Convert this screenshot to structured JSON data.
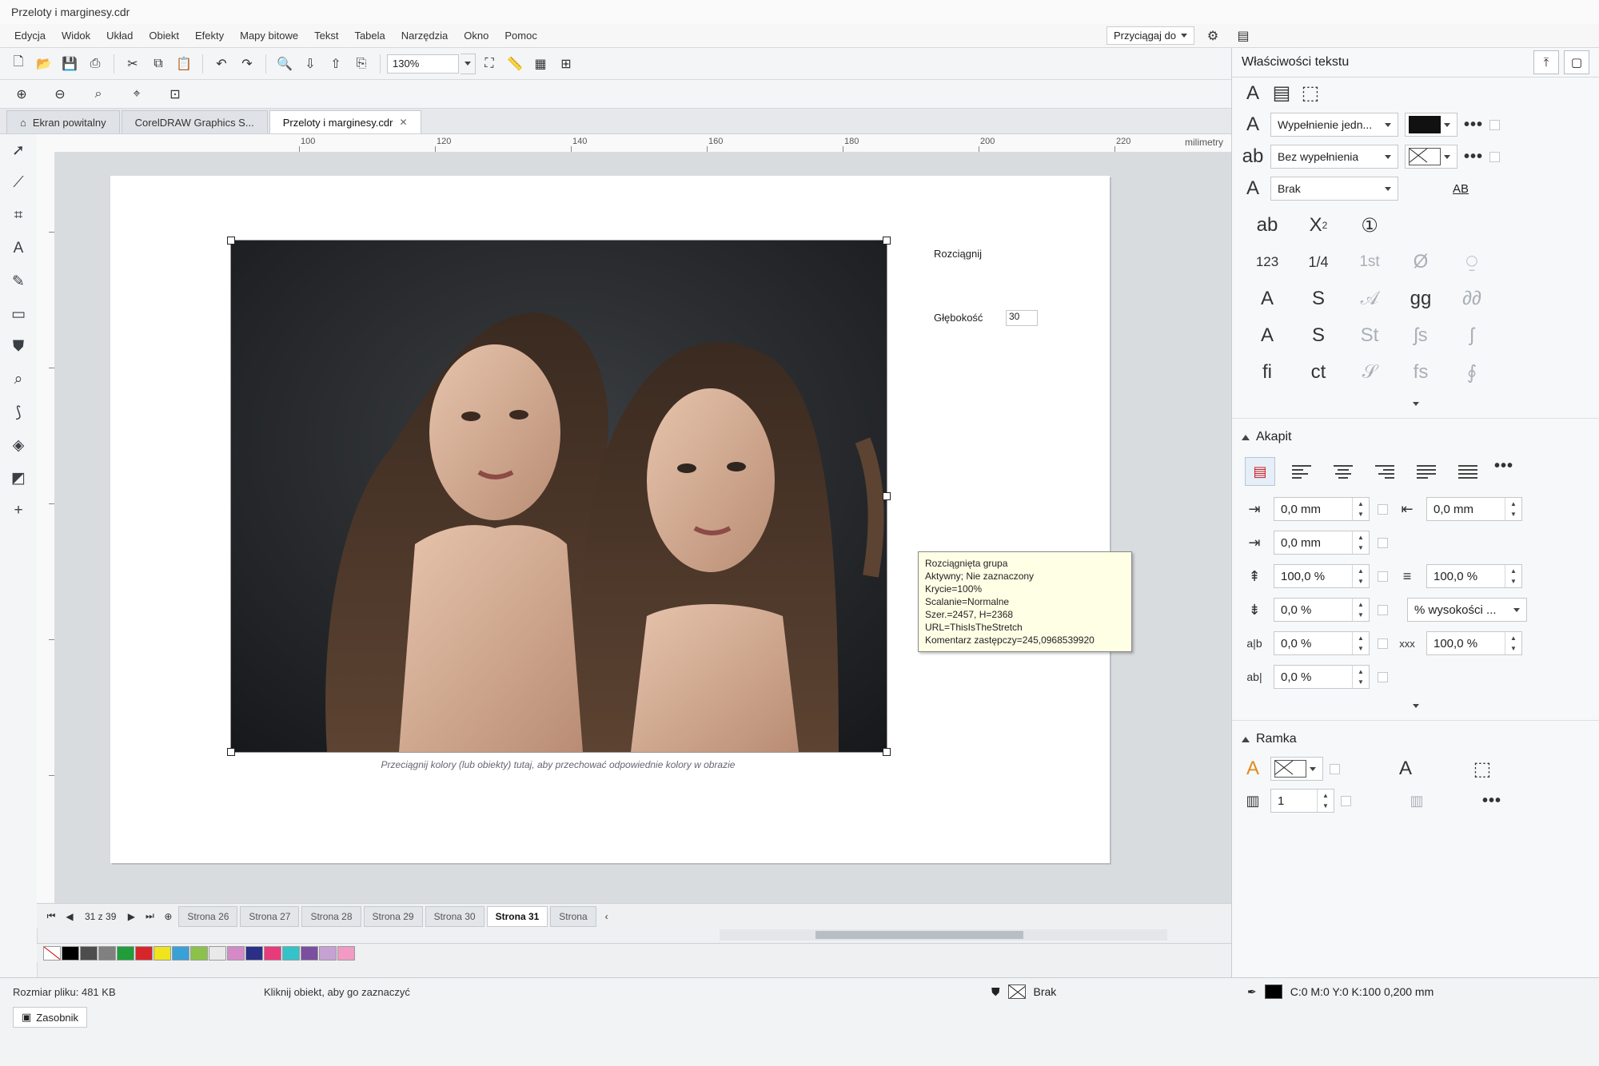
{
  "window": {
    "title": "Przeloty i marginesy.cdr"
  },
  "menu": [
    "Edycja",
    "Widok",
    "Układ",
    "Obiekt",
    "Efekty",
    "Mapy bitowe",
    "Tekst",
    "Tabela",
    "Narzędzia",
    "Okno",
    "Pomoc"
  ],
  "toolbar": {
    "snap_label": "Przyciągaj do",
    "zoom_value": "130%"
  },
  "propbar": {
    "stretch_label": "Rozciągnij",
    "depth_label": "Głębokość",
    "depth_value": "30"
  },
  "tabs": [
    {
      "label": "Ekran powitalny"
    },
    {
      "label": "CorelDRAW Graphics S..."
    },
    {
      "label": "Przeloty i marginesy.cdr"
    }
  ],
  "ruler": {
    "unit": "milimetry",
    "ticks": [
      "100",
      "120",
      "140",
      "160",
      "180",
      "200",
      "220"
    ]
  },
  "canvas": {
    "hint": "Przeciągnij kolory (lub obiekty) tutaj, aby przechować odpowiednie kolory w obrazie",
    "tooltip": [
      "Rozciągnięta grupa",
      "Aktywny; Nie zaznaczony",
      "Krycie=100%",
      "Scalanie=Normalne",
      "Szer.=2457, H=2368",
      "URL=ThisIsTheStretch",
      "Komentarz zastępczy=245,0968539920"
    ]
  },
  "pages": {
    "current": "31",
    "total": "39",
    "count_label": "31 z 39",
    "tabs": [
      "Strona 26",
      "Strona 27",
      "Strona 28",
      "Strona 29",
      "Strona 30",
      "Strona 31",
      "Strona"
    ],
    "active": "Strona 31"
  },
  "palette": [
    "#000000",
    "#4d4d4d",
    "#808080",
    "#1f9e3a",
    "#d7262a",
    "#f0e51c",
    "#3aa0d8",
    "#8bc34a",
    "#e9e9e9",
    "#d48ac6",
    "#2c2f87",
    "#e83b7c",
    "#35c3c9",
    "#7b4fa0",
    "#c6a2d4",
    "#f29ac4"
  ],
  "status": {
    "file_size": "Rozmiar pliku: 481 KB",
    "tip": "Kliknij obiekt, aby go zaznaczyć",
    "docker_tab": "Zasobnik",
    "fill_label": "Brak",
    "outline_label": "C:0 M:0 Y:0 K:100  0,200 mm"
  },
  "docker": {
    "title": "Właściwości tekstu",
    "fill_dd": "Wypełnienie jedn...",
    "bg_dd": "Bez wypełnienia",
    "outline_dd": "Brak",
    "outline_icon_label": "AB",
    "glyphs": {
      "row1": [
        "ab",
        "X",
        "①"
      ],
      "row2": [
        "123",
        "1/4",
        "1st",
        "Ø",
        "⍜"
      ],
      "row3": [
        "A",
        "S",
        "𝒜",
        "gg",
        "∂∂"
      ],
      "row4": [
        "A",
        "S",
        "St",
        "ʃs",
        "ʃ"
      ],
      "row5": [
        "fi",
        "ct",
        "𝒮",
        "fs",
        "∮"
      ]
    },
    "paragraph": {
      "title": "Akapit",
      "indent_first": "0,0 mm",
      "indent_left": "0,0 mm",
      "indent_right": "0,0 mm",
      "spacing_before": "100,0 %",
      "spacing_after": "0,0 %",
      "line_spacing": "100,0 %",
      "line_spacing_unit": "% wysokości ...",
      "char_spacing": "0,0 %",
      "word_spacing": "0,0 %",
      "lang_spacing": "100,0 %"
    },
    "frame": {
      "title": "Ramka",
      "columns": "1"
    }
  },
  "colors": {
    "accent": "#2b6fd6",
    "panel": "#f7f8f9",
    "canvas": "#d9dcdf"
  }
}
